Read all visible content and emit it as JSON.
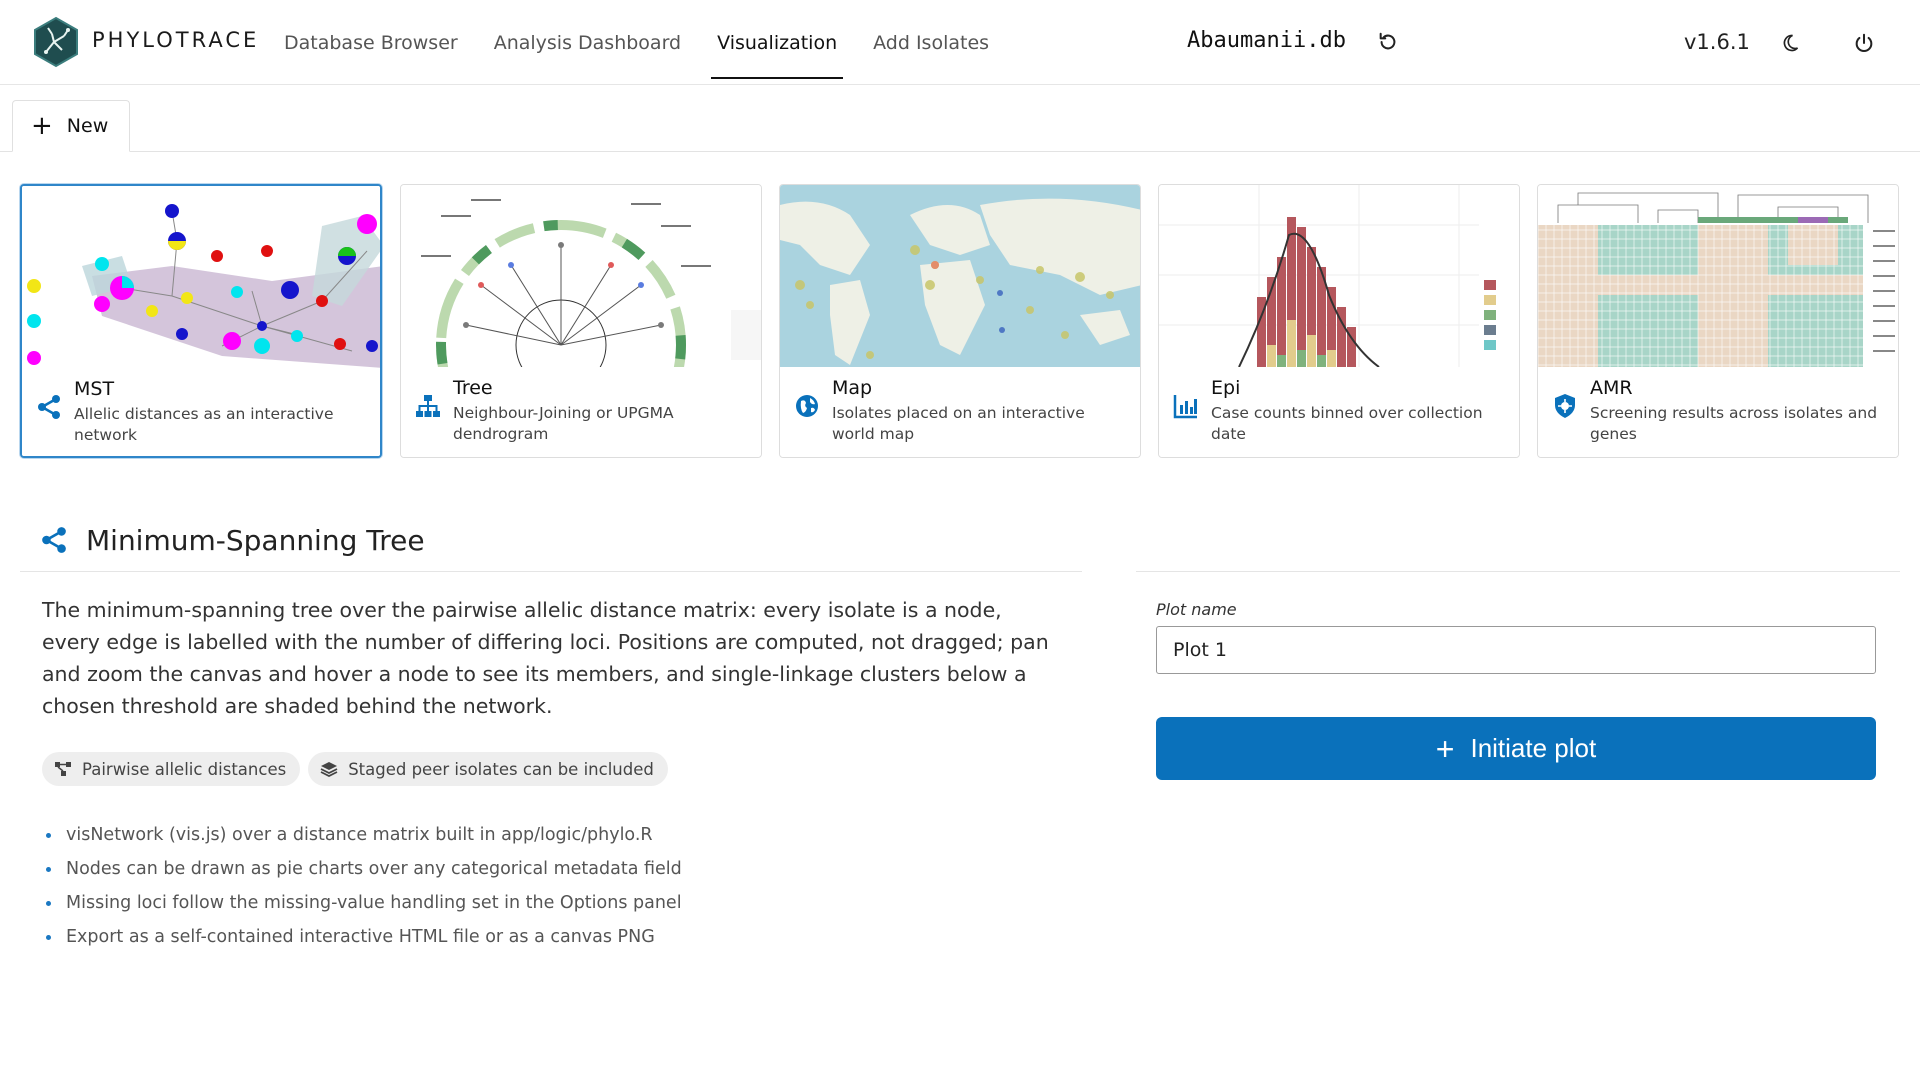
{
  "header": {
    "brand": "PHYLOTRACE",
    "nav": [
      {
        "label": "Database Browser",
        "active": false
      },
      {
        "label": "Analysis Dashboard",
        "active": false
      },
      {
        "label": "Visualization",
        "active": true
      },
      {
        "label": "Add Isolates",
        "active": false
      }
    ],
    "database": "Abaumanii.db",
    "version": "v1.6.1",
    "icons": [
      "refresh-icon",
      "moon-icon",
      "power-icon"
    ]
  },
  "tabs": {
    "new_label": "New"
  },
  "plot_types": [
    {
      "title": "MST",
      "description": "Allelic distances as an interactive network",
      "icon": "share-nodes-icon",
      "selected": true
    },
    {
      "title": "Tree",
      "description": "Neighbour-Joining or UPGMA dendrogram",
      "icon": "sitemap-icon",
      "selected": false
    },
    {
      "title": "Map",
      "description": "Isolates placed on an interactive world map",
      "icon": "globe-icon",
      "selected": false
    },
    {
      "title": "Epi",
      "description": "Case counts binned over collection date",
      "icon": "bar-chart-icon",
      "selected": false
    },
    {
      "title": "AMR",
      "description": "Screening results across isolates and genes",
      "icon": "shield-virus-icon",
      "selected": false
    }
  ],
  "detail": {
    "title": "Minimum-Spanning Tree",
    "description": "The minimum-spanning tree over the pairwise allelic distance matrix: every isolate is a node, every edge is labelled with the number of differing loci. Positions are computed, not dragged; pan and zoom the canvas and hover a node to see its members, and single-linkage clusters below a chosen threshold are shaded behind the network.",
    "chips": [
      {
        "label": "Pairwise allelic distances",
        "icon": "diagram-icon"
      },
      {
        "label": "Staged peer isolates can be included",
        "icon": "layers-icon"
      }
    ],
    "bullets": [
      "visNetwork (vis.js) over a distance matrix built in app/logic/phylo.R",
      "Nodes can be drawn as pie charts over any categorical metadata field",
      "Missing loci follow the missing-value handling set in the Options panel",
      "Export as a self-contained interactive HTML file or as a canvas PNG"
    ]
  },
  "form": {
    "plot_name_label": "Plot name",
    "plot_name_value": "Plot 1",
    "initiate_label": "Initiate plot"
  },
  "colors": {
    "accent": "#0a71bb",
    "selected_border": "#2f86c9"
  }
}
